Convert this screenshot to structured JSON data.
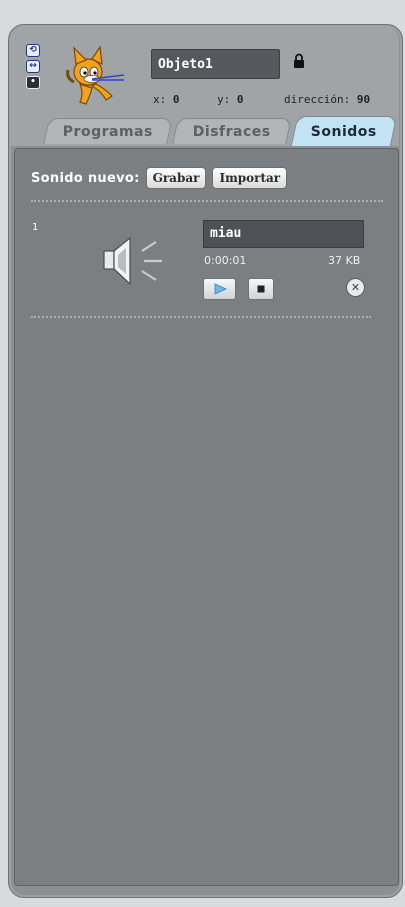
{
  "sprite": {
    "name": "Objeto1",
    "x_label": "x:",
    "x_value": "0",
    "y_label": "y:",
    "y_value": "0",
    "direction_label": "dirección:",
    "direction_value": "90",
    "lock_icon": "lock-icon",
    "rotation_styles": [
      "rotate-icon",
      "flip-horizontal-icon",
      "no-rotate-icon"
    ]
  },
  "tabs": [
    {
      "label": "Programas",
      "active": false
    },
    {
      "label": "Disfraces",
      "active": false
    },
    {
      "label": "Sonidos",
      "active": true
    }
  ],
  "sounds_panel": {
    "new_sound_label": "Sonido nuevo:",
    "record_button": "Grabar",
    "import_button": "Importar"
  },
  "sounds": [
    {
      "index": "1",
      "name": "miau",
      "duration": "0:00:01",
      "size": "37 KB",
      "icon": "speaker-icon"
    }
  ],
  "colors": {
    "frame": "#8c9093",
    "content": "#7b7f82",
    "active_tab": "#c2e3f3",
    "inactive_tab": "#b2b5b7",
    "name_field": "#55595d"
  }
}
